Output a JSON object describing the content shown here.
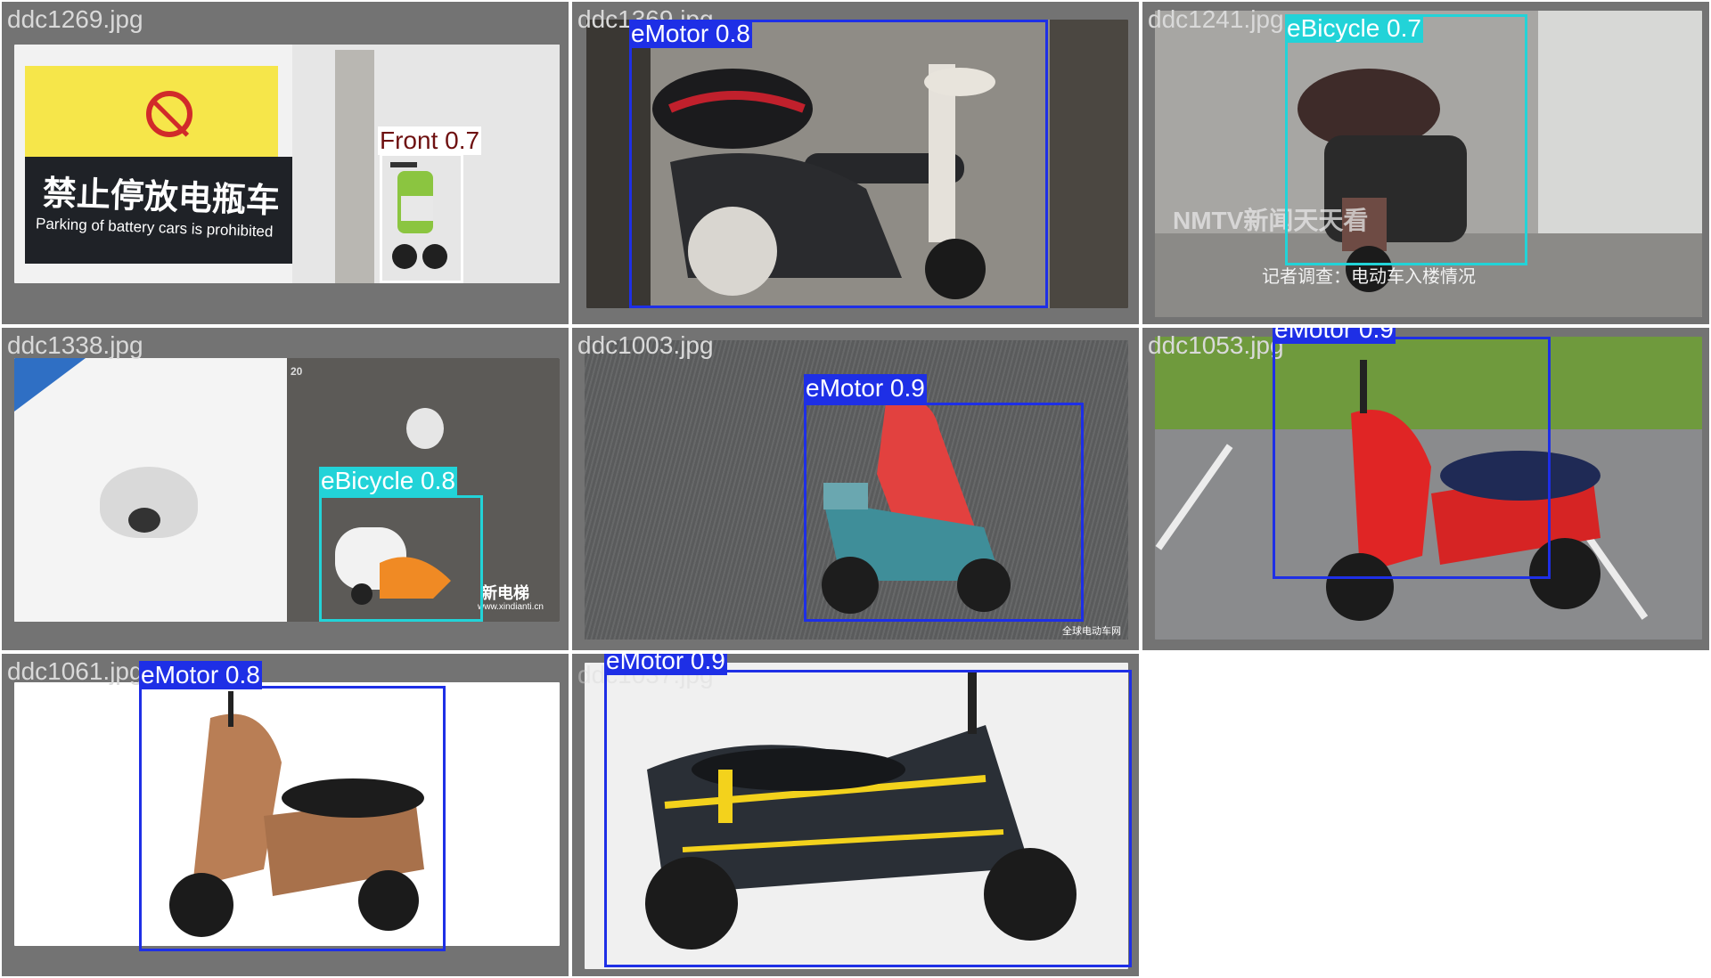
{
  "colors": {
    "tile_bg": "#737373",
    "filename_text": "#d9d9d9",
    "class_colors": {
      "eMotor": "#1e2fe6",
      "eBicycle": "#22d3d8",
      "Front": "#6e1010"
    }
  },
  "tiles": [
    {
      "filename": "ddc1269.jpg",
      "scene": "no-parking-sign-and-scooter",
      "sign_text_cn": "禁止停放电瓶车",
      "sign_text_en": "Parking of battery cars is prohibited",
      "detections": [
        {
          "label": "Front 0.7",
          "class": "Front",
          "confidence": 0.7
        }
      ]
    },
    {
      "filename": "ddc1369.jpg",
      "scene": "scooter-in-elevator",
      "detections": [
        {
          "label": "eMotor 0.8",
          "class": "eMotor",
          "confidence": 0.8
        }
      ]
    },
    {
      "filename": "ddc1241.jpg",
      "scene": "scooter-in-hallway-news",
      "watermark": "NMTV新闻天天看",
      "caption_cn": "记者调查：电动车入楼情况",
      "detections": [
        {
          "label": "eBicycle 0.7",
          "class": "eBicycle",
          "confidence": 0.7
        }
      ]
    },
    {
      "filename": "ddc1338.jpg",
      "scene": "camera-and-elevator-rider",
      "floor_number": "20",
      "watermark_cn": "新电梯",
      "watermark_url": "www.xindianti.cn",
      "detections": [
        {
          "label": "eBicycle 0.8",
          "class": "eBicycle",
          "confidence": 0.8
        }
      ]
    },
    {
      "filename": "ddc1003.jpg",
      "scene": "rider-in-rain",
      "watermark_cn": "全球电动车网",
      "detections": [
        {
          "label": "eMotor 0.9",
          "class": "eMotor",
          "confidence": 0.9
        }
      ]
    },
    {
      "filename": "ddc1053.jpg",
      "scene": "red-scooter-parking-lot",
      "detections": [
        {
          "label": "eMotor 0.9",
          "class": "eMotor",
          "confidence": 0.9
        }
      ]
    },
    {
      "filename": "ddc1061.jpg",
      "scene": "bronze-scooter-studio",
      "detections": [
        {
          "label": "eMotor 0.8",
          "class": "eMotor",
          "confidence": 0.8
        }
      ]
    },
    {
      "filename": "ddc1037.jpg",
      "scene": "black-yellow-sport-scooter",
      "detections": [
        {
          "label": "eMotor 0.9",
          "class": "eMotor",
          "confidence": 0.9
        }
      ]
    }
  ]
}
